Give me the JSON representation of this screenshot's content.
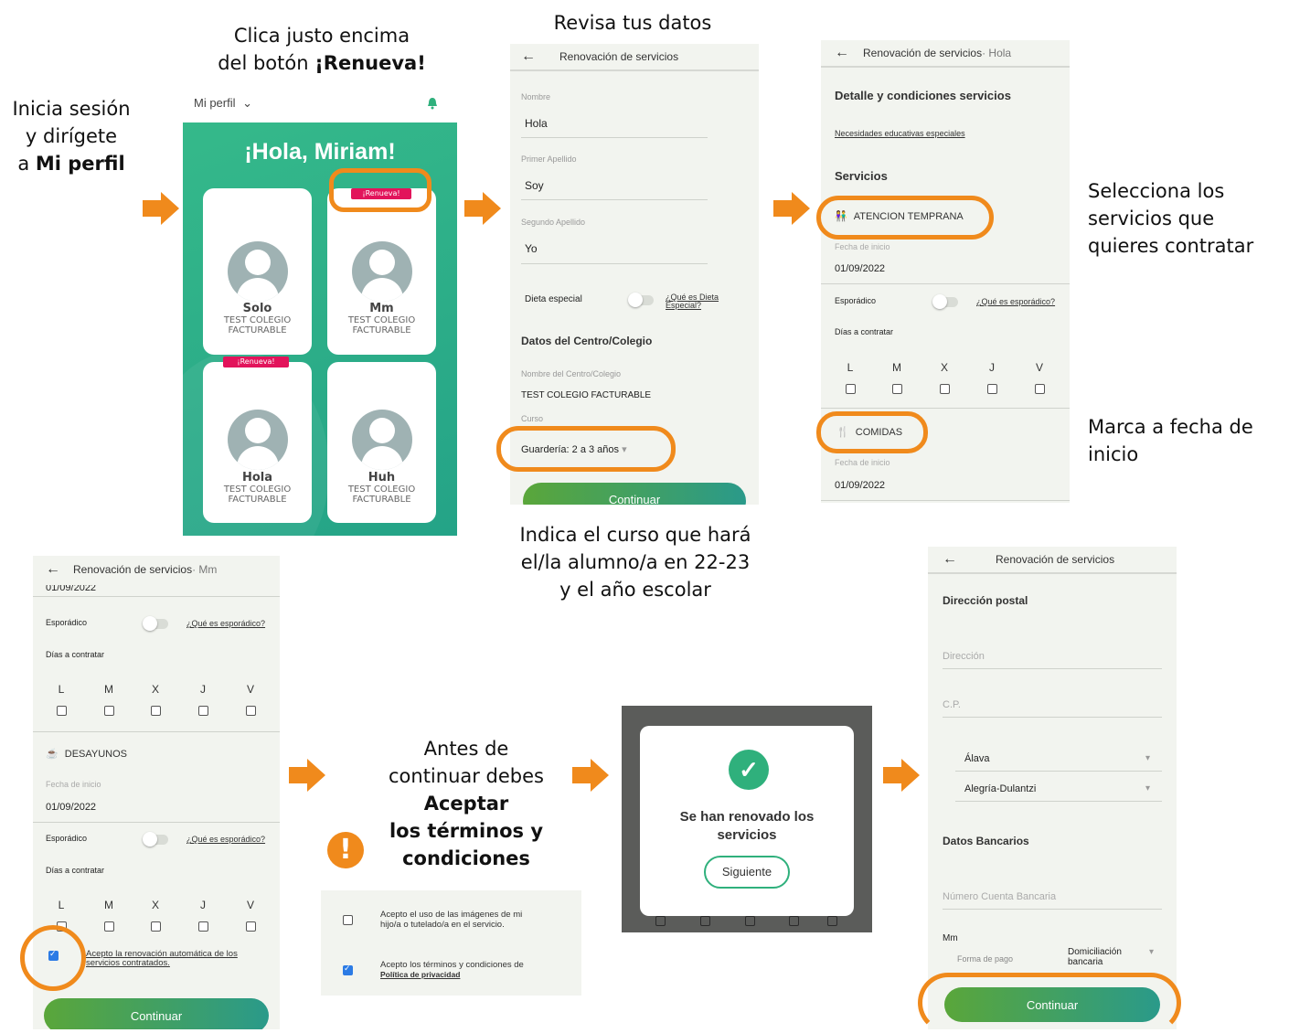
{
  "captions": {
    "step1_line1": "Inicia sesión",
    "step1_line2": "y dirígete",
    "step1_line3a": "a ",
    "step1_line3b": "Mi perfil",
    "step2_line1": "Clica justo encima",
    "step2_line2a": "del botón ",
    "step2_line2b": "¡Renueva!",
    "step3": "Revisa tus datos",
    "step3b_line1": "Indica el curso que hará",
    "step3b_line2": "el/la alumno/a en 22-23",
    "step3b_line3": "y el año escolar",
    "step4a_line1": "Selecciona los",
    "step4a_line2": "servicios que",
    "step4a_line3": "quieres contratar",
    "step4b_line1": "Marca a fecha de",
    "step4b_line2": "inicio",
    "terms_line1": "Antes de",
    "terms_line2": "continuar debes",
    "terms_line3": "Aceptar",
    "terms_line4": "los términos y",
    "terms_line5": "condiciones"
  },
  "colors": {
    "accent": "#f08a1c",
    "green": "#2fb07c",
    "badge": "#e2145b",
    "check": "#2c7be5"
  },
  "screen1": {
    "menu": "Mi perfil",
    "menu_icon": "chevron-down-icon",
    "bell_icon": "bell-icon",
    "greeting": "¡Hola, Miriam!",
    "badge": "¡Renueva!",
    "children": [
      {
        "name": "Solo",
        "school1": "TEST COLEGIO",
        "school2": "FACTURABLE"
      },
      {
        "name": "Mm",
        "school1": "TEST COLEGIO",
        "school2": "FACTURABLE"
      },
      {
        "name": "Hola",
        "school1": "TEST COLEGIO",
        "school2": "FACTURABLE"
      },
      {
        "name": "Huh",
        "school1": "TEST COLEGIO",
        "school2": "FACTURABLE"
      }
    ]
  },
  "screen2": {
    "title": "Renovación de servicios",
    "nombre_label": "Nombre",
    "nombre": "Hola",
    "ap1_label": "Primer Apellido",
    "ap1": "Soy",
    "ap2_label": "Segundo Apellido",
    "ap2": "Yo",
    "dieta": "Dieta especial",
    "dieta_link1": "¿Qué es Dieta",
    "dieta_link2": "Especial?",
    "centro_section": "Datos del Centro/Colegio",
    "centro_label": "Nombre del Centro/Colegio",
    "centro": "TEST COLEGIO FACTURABLE",
    "curso_label": "Curso",
    "curso": "Guardería: 2 a 3 años",
    "continue": "Continuar"
  },
  "screen3": {
    "title": "Renovación de servicios",
    "title_sub": " · Hola",
    "detalle": "Detalle y condiciones servicios",
    "necesidades": "Necesidades educativas especiales",
    "servicios": "Servicios",
    "service1": "ATENCION TEMPRANA",
    "fecha_label": "Fecha de inicio",
    "fecha": "01/09/2022",
    "esporadico": "Esporádico",
    "esporadico_link": "¿Qué es esporádico?",
    "dias": "Días a contratar",
    "days": [
      "L",
      "M",
      "X",
      "J",
      "V"
    ],
    "service2": "COMIDAS",
    "fecha2": "01/09/2022"
  },
  "screen4": {
    "title": "Renovación de servicios",
    "title_sub": " · Mm",
    "top_date": "01/09/2022",
    "esporadico": "Esporádico",
    "esporadico_link": "¿Qué es esporádico?",
    "dias": "Días a contratar",
    "days": [
      "L",
      "M",
      "X",
      "J",
      "V"
    ],
    "service": "DESAYUNOS",
    "fecha_label": "Fecha de inicio",
    "fecha": "01/09/2022",
    "renew_line1": "Acepto la renovación automática de los",
    "renew_line2": "servicios contratados.",
    "continue": "Continuar"
  },
  "terms_box": {
    "item1_line1": "Acepto el uso de las imágenes de mi",
    "item1_line2": "hijo/a o tutelado/a en el servicio.",
    "item2_line1": "Acepto los términos y condiciones de",
    "item2_line2": "Política de privacidad"
  },
  "dialog": {
    "message_line1": "Se han renovado los",
    "message_line2": "servicios",
    "button": "Siguiente"
  },
  "screen6": {
    "title": "Renovación de servicios",
    "postal": "Dirección postal",
    "direccion_ph": "Dirección",
    "cp_ph": "C.P.",
    "province": "Álava",
    "city": "Alegría-Dulantzi",
    "bank": "Datos Bancarios",
    "account_ph": "Número Cuenta Bancaria",
    "child": "Mm",
    "forma_label": "Forma de pago",
    "forma_val1": "Domiciliación",
    "forma_val2": "bancaria",
    "continue": "Continuar"
  }
}
